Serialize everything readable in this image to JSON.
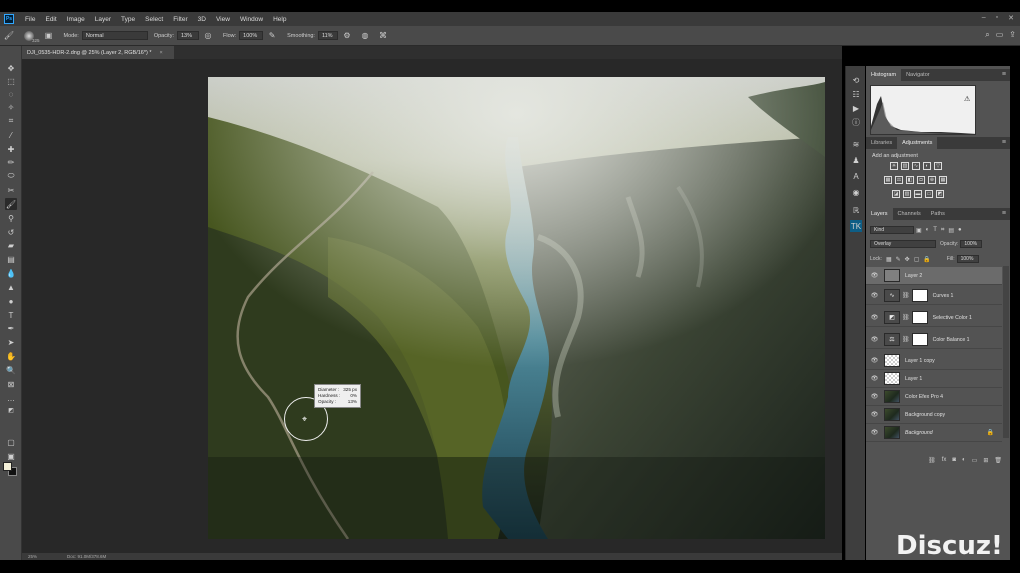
{
  "app": {
    "logo": "Ps"
  },
  "menu": [
    "File",
    "Edit",
    "Image",
    "Layer",
    "Type",
    "Select",
    "Filter",
    "3D",
    "View",
    "Window",
    "Help"
  ],
  "window_controls": [
    "–",
    "▫",
    "✕"
  ],
  "options": {
    "brush_size": "325",
    "mode_label": "Mode:",
    "mode_value": "Normal",
    "opacity_label": "Opacity:",
    "opacity_value": "13%",
    "flow_label": "Flow:",
    "flow_value": "100%",
    "smoothing_label": "Smoothing:",
    "smoothing_value": "11%"
  },
  "document_tab": {
    "title": "DJI_0535-HDR-2.dng @ 25% (Layer 2, RGB/16*) *",
    "close": "×"
  },
  "status": {
    "zoom": "25%",
    "doc": "Doc: 91.0M/378.6M"
  },
  "brush_hud": {
    "diameter_label": "Diameter :",
    "diameter_value": "325 px",
    "hardness_label": "Hardness :",
    "hardness_value": "0%",
    "opacity_label": "Opacity :",
    "opacity_value": "13%"
  },
  "panels": {
    "histogram_tabs": [
      "Histogram",
      "Navigator"
    ],
    "adjust_tabs": [
      "Libraries",
      "Adjustments"
    ],
    "add_adjustment": "Add an adjustment",
    "layers_tabs": [
      "Layers",
      "Channels",
      "Paths"
    ],
    "kind_filter": "Kind",
    "blend_mode": "Overlay",
    "opacity_label": "Opacity:",
    "opacity_value": "100%",
    "lock_label": "Lock:",
    "fill_label": "Fill:",
    "fill_value": "100%"
  },
  "layers": [
    {
      "name": "Layer 2",
      "type": "pixel-empty",
      "selected": true
    },
    {
      "name": "Curves 1",
      "type": "adjustment",
      "icon": "curves-icon"
    },
    {
      "name": "Selective Color 1",
      "type": "adjustment",
      "icon": "selective-color-icon"
    },
    {
      "name": "Color Balance 1",
      "type": "adjustment",
      "icon": "color-balance-icon"
    },
    {
      "name": "Layer 1 copy",
      "type": "pixel-empty"
    },
    {
      "name": "Layer 1",
      "type": "pixel-empty"
    },
    {
      "name": "Color Efex Pro 4",
      "type": "photo"
    },
    {
      "name": "Background copy",
      "type": "photo"
    },
    {
      "name": "Background",
      "type": "photo",
      "locked": true,
      "italic": true
    }
  ],
  "colors": {
    "foreground": "#f4f0d8",
    "background": "#111111",
    "accent": "#31a8ff"
  },
  "watermark": "Discuz!"
}
